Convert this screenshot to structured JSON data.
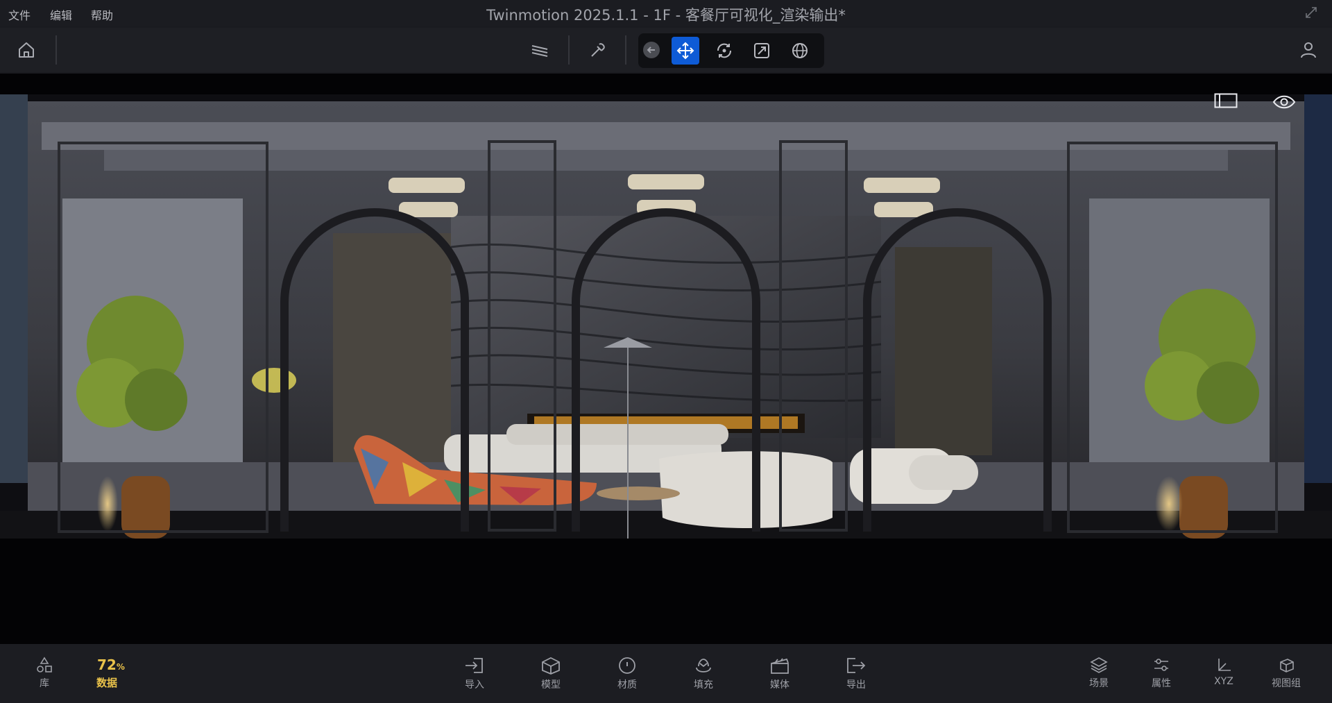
{
  "titlebar": {
    "menus": [
      "文件",
      "编辑",
      "帮助"
    ],
    "title": "Twinmotion 2025.1.1 - 1F - 客餐厅可视化_渲染输出*"
  },
  "toolbar": {
    "icons": [
      "home-icon",
      "layers-icon",
      "eyedropper-icon",
      "back-arrow-icon",
      "move-icon",
      "rotate-icon",
      "scale-icon",
      "globe-icon",
      "user-icon"
    ],
    "active_tool": "move"
  },
  "viewport": {
    "icons": [
      "frame-icon",
      "eye-icon"
    ]
  },
  "bottombar": {
    "library_label": "库",
    "data_value": "72",
    "data_unit": "%",
    "data_label": "数据",
    "accent_color": "#e9c24a",
    "center_items": [
      "导入",
      "模型",
      "材质",
      "填充",
      "媒体",
      "导出"
    ],
    "right_items": [
      "场景",
      "属性",
      "XYZ",
      "视图组"
    ]
  },
  "colors": {
    "active_blue": "#0e5bd6",
    "background": "#1a1b20"
  }
}
